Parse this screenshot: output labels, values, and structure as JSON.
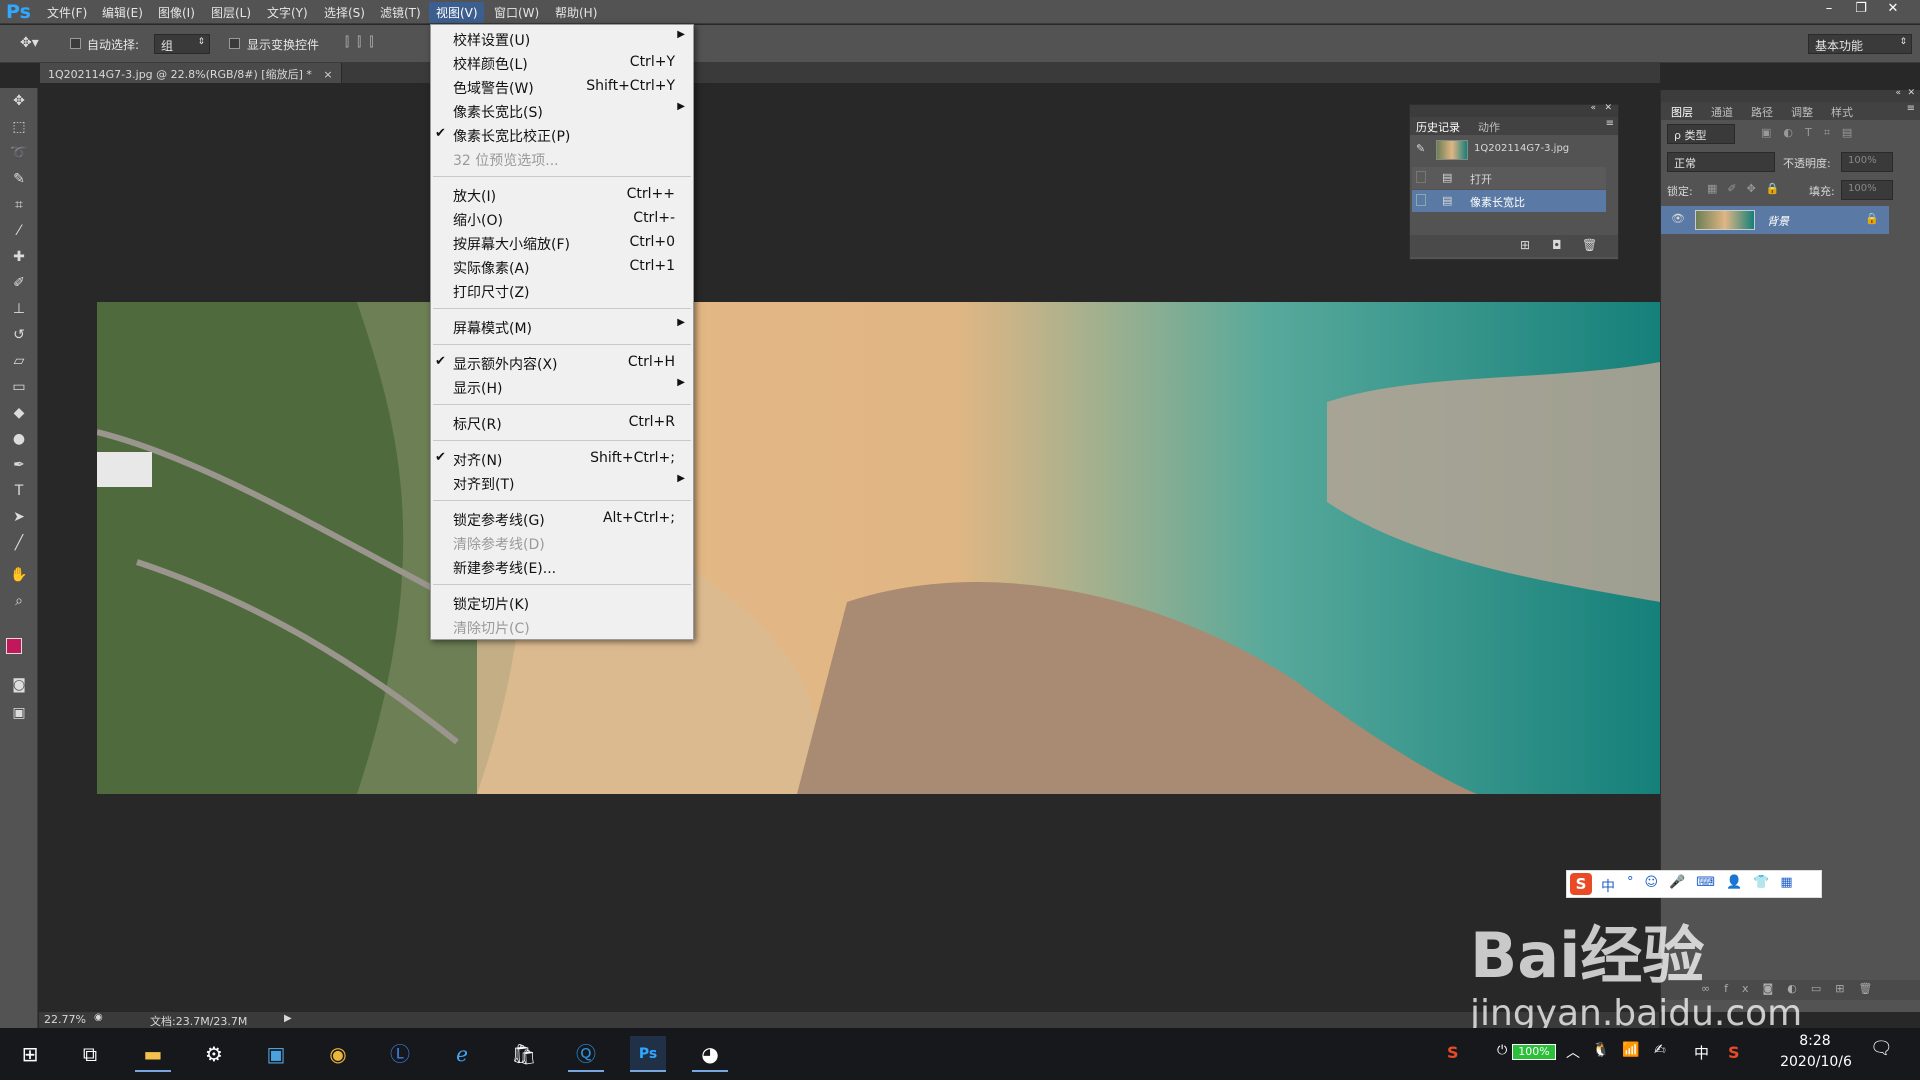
{
  "app": {
    "logo": "Ps"
  },
  "menubar": {
    "items": [
      "文件(F)",
      "编辑(E)",
      "图像(I)",
      "图层(L)",
      "文字(Y)",
      "选择(S)",
      "滤镜(T)",
      "视图(V)",
      "窗口(W)",
      "帮助(H)"
    ],
    "window_buttons": [
      "–",
      "❐",
      "✕"
    ]
  },
  "options": {
    "auto_select_label": "自动选择:",
    "auto_select_value": "组",
    "show_transform_label": "显示变换控件",
    "workspace": "基本功能"
  },
  "document": {
    "tab_title": "1Q202114G7-3.jpg @ 22.8%(RGB/8#) [缩放后] *",
    "close": "×"
  },
  "statusbar": {
    "zoom": "22.77%",
    "doc_info": "文档:23.7M/23.7M"
  },
  "view_menu": {
    "items": [
      {
        "label": "校样设置(U)",
        "shortcut": "",
        "submenu": true,
        "checked": false,
        "disabled": false
      },
      {
        "label": "校样颜色(L)",
        "shortcut": "Ctrl+Y",
        "submenu": false,
        "checked": false,
        "disabled": false
      },
      {
        "label": "色域警告(W)",
        "shortcut": "Shift+Ctrl+Y",
        "submenu": false,
        "checked": false,
        "disabled": false
      },
      {
        "label": "像素长宽比(S)",
        "shortcut": "",
        "submenu": true,
        "checked": false,
        "disabled": false
      },
      {
        "label": "像素长宽比校正(P)",
        "shortcut": "",
        "submenu": false,
        "checked": true,
        "disabled": false
      },
      {
        "label": "32 位预览选项...",
        "shortcut": "",
        "submenu": false,
        "checked": false,
        "disabled": true
      },
      {
        "label": "放大(I)",
        "shortcut": "Ctrl++",
        "submenu": false,
        "checked": false,
        "disabled": false
      },
      {
        "label": "缩小(O)",
        "shortcut": "Ctrl+-",
        "submenu": false,
        "checked": false,
        "disabled": false
      },
      {
        "label": "按屏幕大小缩放(F)",
        "shortcut": "Ctrl+0",
        "submenu": false,
        "checked": false,
        "disabled": false
      },
      {
        "label": "实际像素(A)",
        "shortcut": "Ctrl+1",
        "submenu": false,
        "checked": false,
        "disabled": false
      },
      {
        "label": "打印尺寸(Z)",
        "shortcut": "",
        "submenu": false,
        "checked": false,
        "disabled": false
      },
      {
        "label": "屏幕模式(M)",
        "shortcut": "",
        "submenu": true,
        "checked": false,
        "disabled": false
      },
      {
        "label": "显示额外内容(X)",
        "shortcut": "Ctrl+H",
        "submenu": false,
        "checked": true,
        "disabled": false
      },
      {
        "label": "显示(H)",
        "shortcut": "",
        "submenu": true,
        "checked": false,
        "disabled": false
      },
      {
        "label": "标尺(R)",
        "shortcut": "Ctrl+R",
        "submenu": false,
        "checked": false,
        "disabled": false
      },
      {
        "label": "对齐(N)",
        "shortcut": "Shift+Ctrl+;",
        "submenu": false,
        "checked": true,
        "disabled": false
      },
      {
        "label": "对齐到(T)",
        "shortcut": "",
        "submenu": true,
        "checked": false,
        "disabled": false
      },
      {
        "label": "锁定参考线(G)",
        "shortcut": "Alt+Ctrl+;",
        "submenu": false,
        "checked": false,
        "disabled": false
      },
      {
        "label": "清除参考线(D)",
        "shortcut": "",
        "submenu": false,
        "checked": false,
        "disabled": true
      },
      {
        "label": "新建参考线(E)...",
        "shortcut": "",
        "submenu": false,
        "checked": false,
        "disabled": false
      },
      {
        "label": "锁定切片(K)",
        "shortcut": "",
        "submenu": false,
        "checked": false,
        "disabled": false
      },
      {
        "label": "清除切片(C)",
        "shortcut": "",
        "submenu": false,
        "checked": false,
        "disabled": true
      }
    ]
  },
  "history_panel": {
    "tabs": [
      "历史记录",
      "动作"
    ],
    "snapshot": "1Q202114G7-3.jpg",
    "states": [
      "打开",
      "像素长宽比"
    ]
  },
  "layers_panel": {
    "tabs": [
      "图层",
      "通道",
      "路径",
      "调整",
      "样式"
    ],
    "filter_label": "ρ 类型",
    "blend_mode": "正常",
    "opacity_label": "不透明度:",
    "opacity_value": "100%",
    "lock_label": "锁定:",
    "fill_label": "填充:",
    "fill_value": "100%",
    "layer_name": "背景"
  },
  "ime": {
    "lang": "中"
  },
  "taskbar": {
    "battery": "100%",
    "ime_lang": "中",
    "time": "8:28",
    "date": "2020/10/6"
  },
  "watermark": {
    "line1": "Bai经验",
    "line2": "jingyan.baidu.com"
  }
}
